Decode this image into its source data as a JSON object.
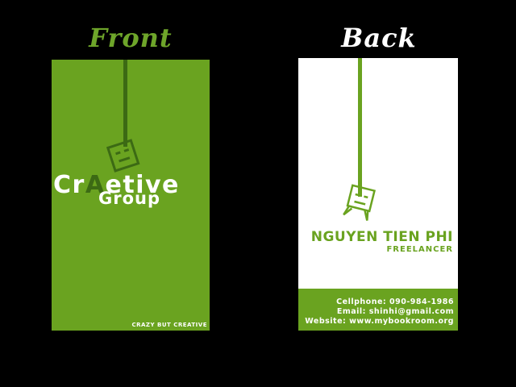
{
  "front": {
    "heading": "Front",
    "brand_part1": "Cr",
    "brand_accent": "A",
    "brand_part2": "etive",
    "brand_sub": "Group",
    "tagline": "CRAZY BUT CREATIVE"
  },
  "back": {
    "heading": "Back",
    "name": "NGUYEN TIEN PHI",
    "role": "FREELANCER",
    "cellphone": "Cellphone: 090-984-1986",
    "email": "Email: shinhi@gmail.com",
    "website": "Website: www.mybookroom.org"
  },
  "colors": {
    "green": "#6aa320",
    "dark_green": "#3c6a14",
    "background": "#000000"
  },
  "icons": [
    "box-creature-icon"
  ]
}
